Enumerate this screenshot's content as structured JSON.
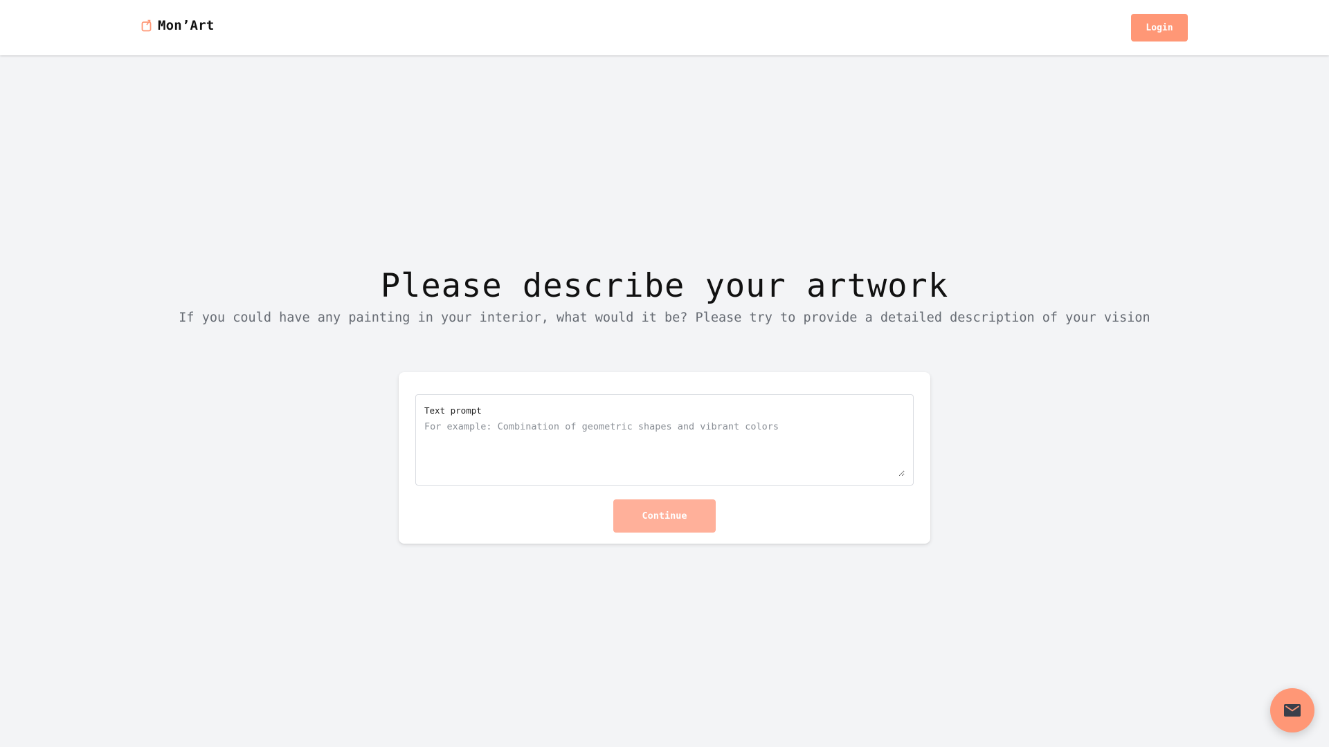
{
  "header": {
    "brand_name": "Mon’Art",
    "brand_icon": "frame-icon",
    "login_label": "Login"
  },
  "main": {
    "title": "Please describe your artwork",
    "subtitle": "If you could have any painting in your interior, what would it be? Please try to provide a detailed description of your vision"
  },
  "form": {
    "prompt_label": "Text prompt",
    "prompt_value": "",
    "prompt_placeholder": "For example: Combination of geometric shapes and vibrant colors",
    "continue_label": "Continue"
  },
  "fab": {
    "icon": "mail-icon"
  },
  "colors": {
    "accent": "#ff9776",
    "accent_disabled": "#ffb09a",
    "background": "#f3f4f6"
  }
}
